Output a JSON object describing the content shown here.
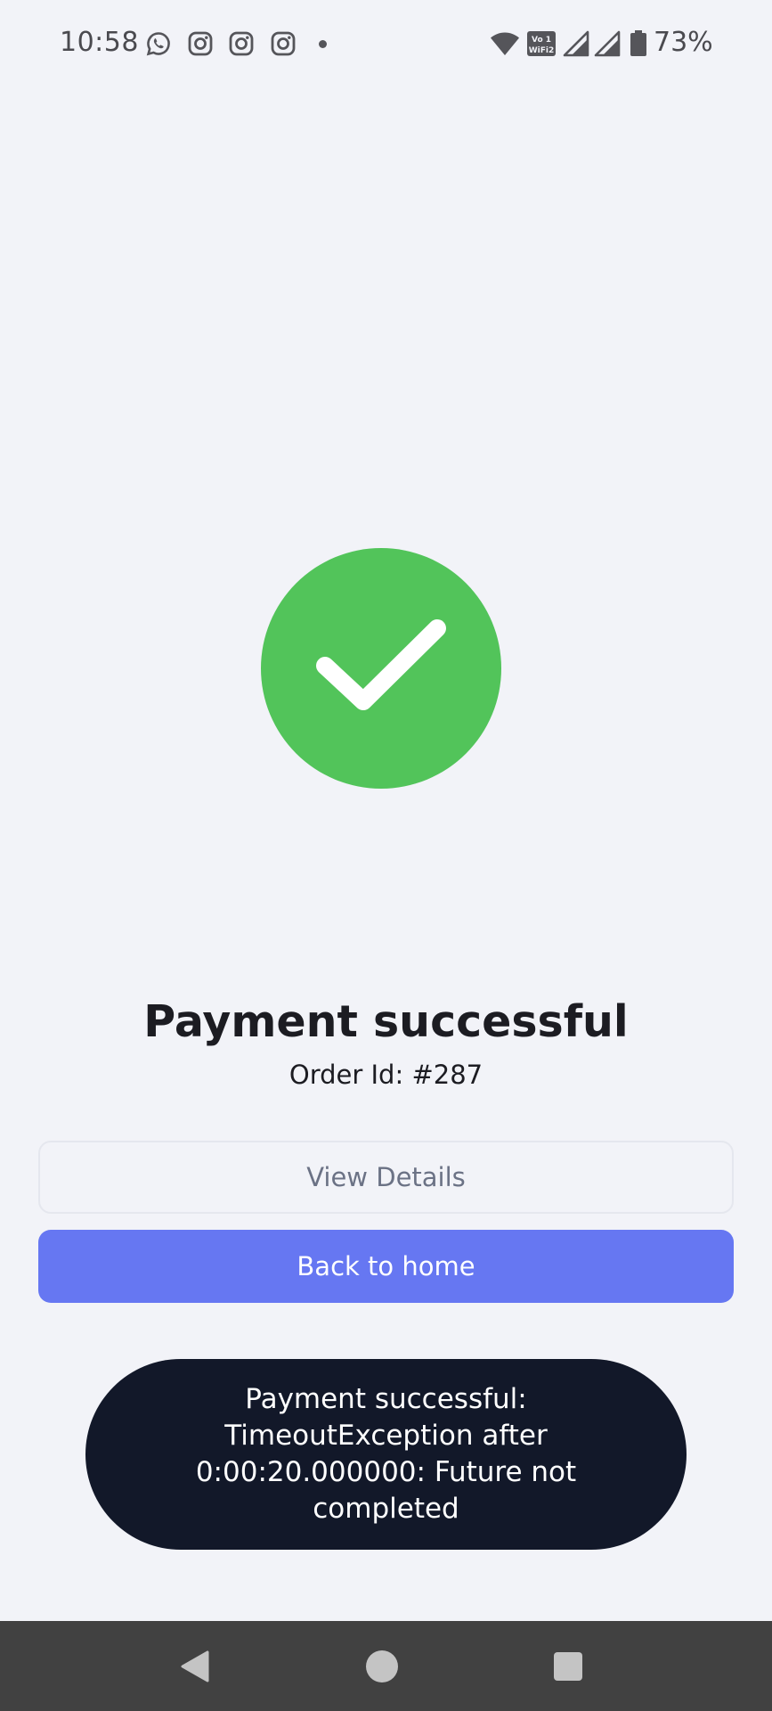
{
  "status_bar": {
    "time": "10:58",
    "notification_icons": [
      "whatsapp-icon",
      "instagram-icon",
      "instagram-icon",
      "instagram-icon"
    ],
    "system_icons": [
      "wifi-icon",
      "vowifi-icon",
      "signal-icon",
      "signal-icon",
      "battery-icon"
    ],
    "vowifi_label": "Vo WiFi",
    "battery_percent": "73%"
  },
  "main": {
    "status_icon": "check-circle-icon",
    "title": "Payment successful",
    "order_id": "Order Id: #287",
    "view_details_label": "View Details",
    "back_home_label": "Back to home"
  },
  "toast": {
    "message": "Payment successful: TimeoutException after 0:00:20.000000: Future not completed"
  },
  "nav_bar": {
    "buttons": [
      "back-icon",
      "home-icon",
      "recents-icon"
    ]
  },
  "colors": {
    "background": "#f2f3f8",
    "success_green": "#52c45a",
    "primary_button": "#6677f2",
    "toast_background": "#121829",
    "nav_bar": "#414141"
  }
}
